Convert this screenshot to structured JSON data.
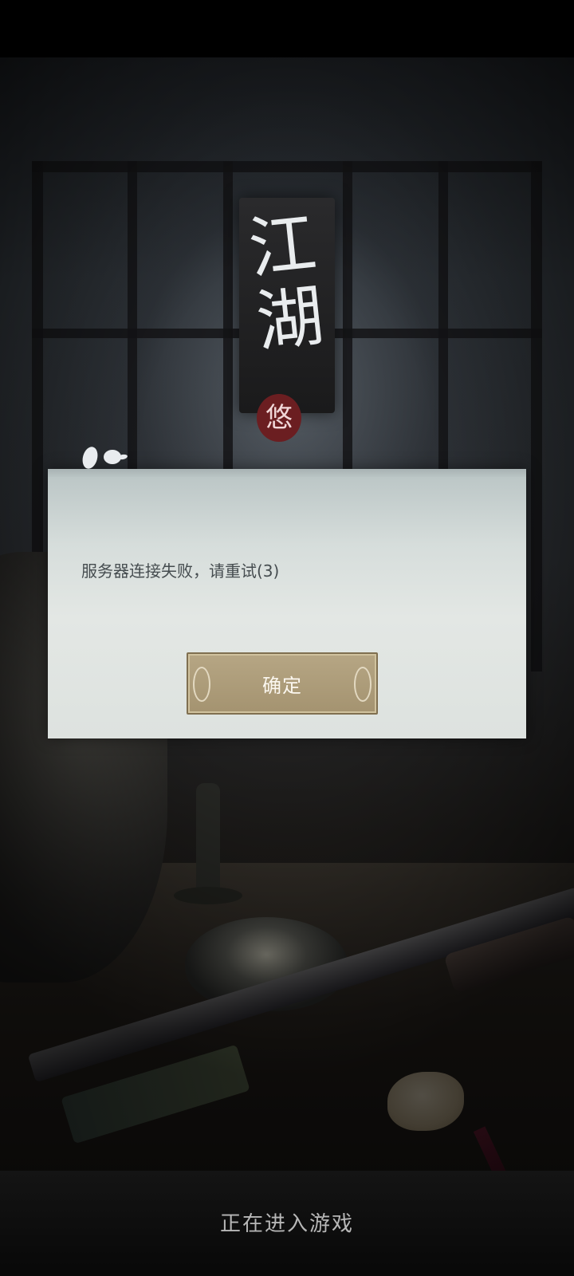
{
  "background": {
    "logo_text_lines": [
      "江",
      "湖"
    ],
    "seal_text": "悠"
  },
  "dialog": {
    "message": "服务器连接失败，请重试(3)",
    "confirm_label": "确定"
  },
  "footer": {
    "loading_text": "正在进入游戏"
  },
  "colors": {
    "dialog_bg": "#e0e5e2",
    "button_bg": "#ab9a77",
    "button_text": "#fbf7ef",
    "message_text": "#454c4f",
    "loading_text": "#b7b7b7"
  }
}
